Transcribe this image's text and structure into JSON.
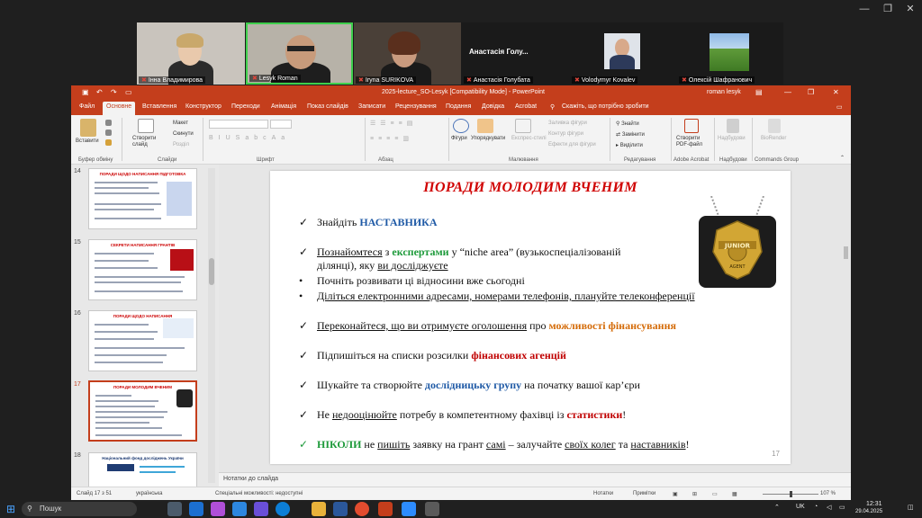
{
  "zoom": {
    "tiles": [
      {
        "name": "Інна Владимирова"
      },
      {
        "name": "Lesyk Roman"
      },
      {
        "name": "Iryna SURIKOVA"
      },
      {
        "name": "Анастасія Голубата",
        "big": "Анастасія Голу..."
      },
      {
        "name": "Volodymyr Kovalev"
      },
      {
        "name": "Олексій Шафранович"
      }
    ]
  },
  "ppt": {
    "doc_title": "2025-lecture_SO-Lesyk [Compatibility Mode]  -  PowerPoint",
    "user": "roman lesyk",
    "menu": [
      "Файл",
      "Основне",
      "Вставлення",
      "Конструктор",
      "Переходи",
      "Анімація",
      "Показ слайдів",
      "Записати",
      "Рецензування",
      "Подання",
      "Довідка",
      "Acrobat",
      "Скажіть, що потрібно зробити"
    ],
    "active_menu": "Основне",
    "ribbon": {
      "paste": "Вставити",
      "new_slide": "Створити слайд",
      "layout": "Макет",
      "reset": "Скинути",
      "section": "Розділ",
      "shapes": "Фігури",
      "arrange": "Упорядкувати",
      "quick_styles": "Експрес-стилі",
      "shape_fill": "Заливка фігури",
      "shape_outline": "Контур фігури",
      "shape_effects": "Ефекти для фігури",
      "find": "Знайти",
      "replace": "Замінити",
      "select": "Виділити",
      "create_pdf": "Створити PDF-файл",
      "send_to": "Надбудови",
      "biorender": "BioRender",
      "groups": {
        "clipboard": "Буфер обміну",
        "slides": "Слайди",
        "font": "Шрифт",
        "paragraph": "Абзац",
        "drawing": "Малювання",
        "editing": "Редагування",
        "acrobat": "Adobe Acrobat",
        "addins": "Надбудови",
        "commands": "Commands Group"
      }
    },
    "thumbs": [
      {
        "num": "14",
        "title": "ПОРАДИ ЩОДО НАПИСАННЯ ПІДГОТОВКА"
      },
      {
        "num": "15",
        "title": "СЕКРЕТИ НАПИСАННЯ ГРАНТІВ"
      },
      {
        "num": "16",
        "title": "ПОРАДИ ЩОДО НАПИСАННЯ"
      },
      {
        "num": "17",
        "title": "ПОРАДИ МОЛОДИМ ВЧЕНИМ"
      },
      {
        "num": "18",
        "title": "Національний фонд досліджень України"
      }
    ],
    "slide": {
      "title": "ПОРАДИ МОЛОДИМ ВЧЕНИМ",
      "number": "17",
      "b1": {
        "a": "Знайдіть ",
        "b": "НАСТАВНИКА"
      },
      "b2": {
        "a": "Познайомтеся",
        "b": " з ",
        "c": "експертами",
        "d": " у “niche area” (вузькоспеціалізованій"
      },
      "b2b": {
        "a": "ділянці), яку ",
        "b": "ви досліджуєте"
      },
      "b3": "Почніть розвивати ці відносини вже сьогодні",
      "b4": "Діліться електронними адресами, номерами телефонів, плануйте телеконференції",
      "b5": {
        "a": "Переконайтеся, що ви отримуєте оголошення",
        "b": " про ",
        "c": "можливості фінансування"
      },
      "b6": {
        "a": "Підпишіться на списки розсилки ",
        "b": "фінансових агенцій"
      },
      "b7": {
        "a": "Шукайте та створюйте ",
        "b": "дослідницьку групу",
        "c": " на початку вашої кар’єри"
      },
      "b8": {
        "a": "Не ",
        "b": "недооцінюйте",
        "c": " потребу в компетентному фахівці із ",
        "d": "статистики",
        "e": "!"
      },
      "b9": {
        "a": "НІКОЛИ",
        "b": " не ",
        "c": "пишіть",
        "d": " заявку на грант ",
        "e": "самі",
        "f": " – залучайте ",
        "g": "своїх колег",
        "h": " та ",
        "i": "наставників",
        "j": "!"
      },
      "badge_text": "JUNIOR",
      "badge_sub": "AGENT"
    },
    "notes": "Нотатки до слайда",
    "status": {
      "slide": "Слайд 17 з 51",
      "lang": "українська",
      "accessibility": "Спеціальні можливості: недоступні",
      "notes": "Нотатки",
      "comments": "Примітки",
      "zoom": "107 %"
    }
  },
  "taskbar": {
    "search": "Пошук",
    "lang": "UK",
    "time": "12:31",
    "date": "29.04.2025"
  }
}
